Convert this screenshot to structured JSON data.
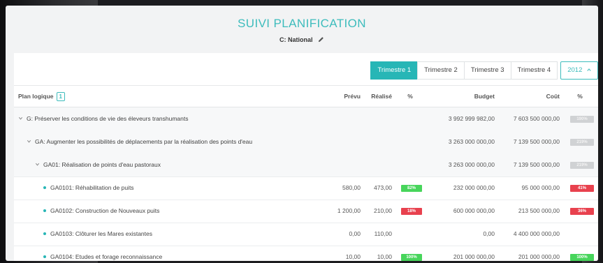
{
  "header": {
    "title": "SUIVI PLANIFICATION",
    "subtitle": "C: National"
  },
  "tabs": [
    {
      "label": "Trimestre 1",
      "active": true
    },
    {
      "label": "Trimestre 2",
      "active": false
    },
    {
      "label": "Trimestre 3",
      "active": false
    },
    {
      "label": "Trimestre 4",
      "active": false
    }
  ],
  "year_select": "2012",
  "columns": {
    "plan": "Plan logique",
    "plan_count": "1",
    "prevu": "Prévu",
    "realise": "Réalisé",
    "pct1": "%",
    "budget": "Budget",
    "cout": "Coût",
    "pct2": "%"
  },
  "rows": [
    {
      "level": 0,
      "label": "G: Préserver les conditions de vie des éleveurs transhumants",
      "prevu": "",
      "realise": "",
      "pct1": "",
      "pct1_color": "",
      "budget": "3 992 999 982,00",
      "cout": "7 603 500 000,00",
      "pct2": "190%",
      "pct2_color": "grey"
    },
    {
      "level": 1,
      "label": "GA: Augmenter les possibilités de déplacements par la réalisation des points d'eau",
      "prevu": "",
      "realise": "",
      "pct1": "",
      "pct1_color": "",
      "budget": "3 263 000 000,00",
      "cout": "7 139 500 000,00",
      "pct2": "219%",
      "pct2_color": "grey"
    },
    {
      "level": 2,
      "label": "GA01: Réalisation de points d'eau pastoraux",
      "prevu": "",
      "realise": "",
      "pct1": "",
      "pct1_color": "",
      "budget": "3 263 000 000,00",
      "cout": "7 139 500 000,00",
      "pct2": "219%",
      "pct2_color": "grey"
    },
    {
      "level": 3,
      "label": "GA0101: Réhabilitation de puits",
      "prevu": "580,00",
      "realise": "473,00",
      "pct1": "82%",
      "pct1_color": "green",
      "budget": "232 000 000,00",
      "cout": "95 000 000,00",
      "pct2": "41%",
      "pct2_color": "red"
    },
    {
      "level": 3,
      "label": "GA0102: Construction de Nouveaux puits",
      "prevu": "1 200,00",
      "realise": "210,00",
      "pct1": "18%",
      "pct1_color": "red",
      "budget": "600 000 000,00",
      "cout": "213 500 000,00",
      "pct2": "36%",
      "pct2_color": "red"
    },
    {
      "level": 3,
      "label": "GA0103: Clôturer les Mares existantes",
      "prevu": "0,00",
      "realise": "110,00",
      "pct1": "",
      "pct1_color": "",
      "budget": "0,00",
      "cout": "4 400 000 000,00",
      "pct2": "",
      "pct2_color": ""
    },
    {
      "level": 3,
      "label": "GA0104: Etudes et forage reconnaissance",
      "prevu": "10,00",
      "realise": "10,00",
      "pct1": "100%",
      "pct1_color": "green",
      "budget": "201 000 000,00",
      "cout": "201 000 000,00",
      "pct2": "100%",
      "pct2_color": "green"
    }
  ]
}
